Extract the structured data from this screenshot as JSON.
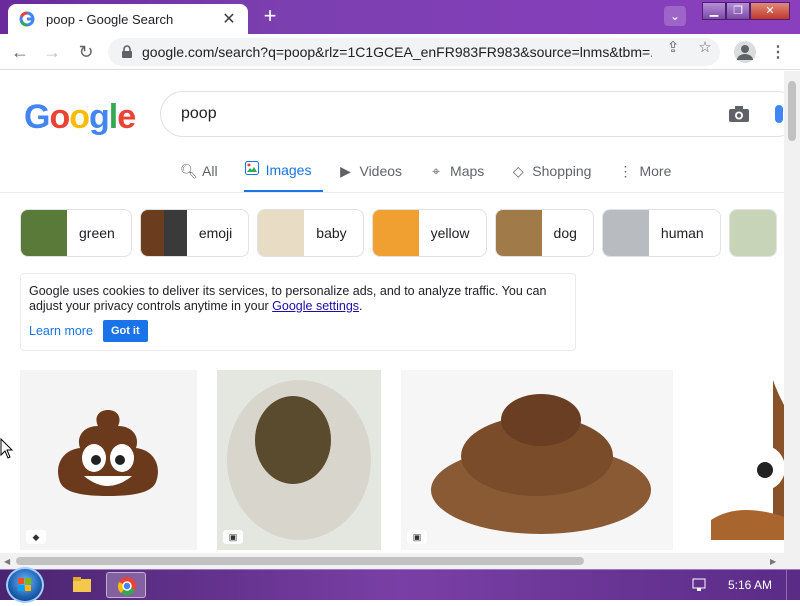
{
  "browser": {
    "tab_title": "poop - Google Search",
    "url": "google.com/search?q=poop&rlz=1C1GCEA_enFR983FR983&source=lnms&tbm=...",
    "new_tab_symbol": "+",
    "close_tab_symbol": "✕",
    "menu_symbol": "⋮"
  },
  "search": {
    "logo": [
      "G",
      "o",
      "o",
      "g",
      "l",
      "e"
    ],
    "logo_colors": [
      "#4285f4",
      "#ea4335",
      "#fbbc05",
      "#4285f4",
      "#34a853",
      "#ea4335"
    ],
    "query": "poop"
  },
  "nav_tabs": [
    {
      "label": "All",
      "icon": "search-icon",
      "glyph": "🔍︎"
    },
    {
      "label": "Images",
      "icon": "image-icon",
      "glyph": "▣"
    },
    {
      "label": "Videos",
      "icon": "video-icon",
      "glyph": "▶"
    },
    {
      "label": "Maps",
      "icon": "map-pin-icon",
      "glyph": "⌖"
    },
    {
      "label": "Shopping",
      "icon": "tag-icon",
      "glyph": "◇"
    },
    {
      "label": "More",
      "icon": "more-vert-icon",
      "glyph": "⋮"
    }
  ],
  "active_tab": "Images",
  "chips": [
    {
      "label": "green",
      "thumb_color": "#5a7a3a"
    },
    {
      "label": "emoji",
      "thumb_color": "#6b3d1e"
    },
    {
      "label": "baby",
      "thumb_color": "#d9c8a6"
    },
    {
      "label": "yellow",
      "thumb_color": "#f0a030"
    },
    {
      "label": "dog",
      "thumb_color": "#8a6a3a"
    },
    {
      "label": "human",
      "thumb_color": "#9aa0a6"
    },
    {
      "label": "",
      "thumb_color": "#c8c8c0"
    }
  ],
  "cookie": {
    "text_before": "Google uses cookies to deliver its services, to personalize ads, and to analyze traffic. You can adjust your privacy controls anytime in your ",
    "link": "Google settings",
    "text_after": ".",
    "learn_more": "Learn more",
    "got_it": "Got it"
  },
  "taskbar": {
    "time": "5:16 AM"
  },
  "colors": {
    "accent": "#1a73e8",
    "titlebar": "#7b3fb0"
  }
}
